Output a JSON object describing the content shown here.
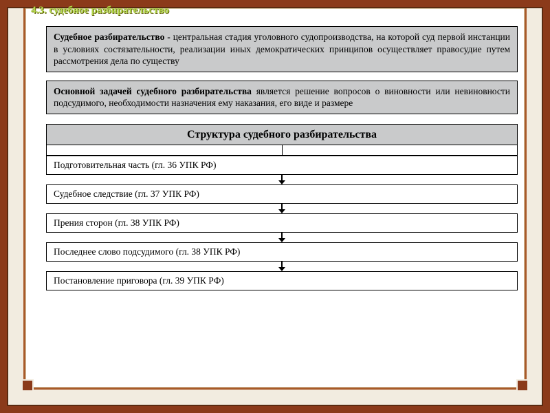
{
  "header": {
    "section_number": "4.3.",
    "section_title": "судебное разбирательство"
  },
  "definition": {
    "term": "Судебное разбирательство",
    "dash": " - ",
    "text": "центральная стадия уголовного судопроизводства, на которой суд первой инстанции в условиях состязательности, реализации иных демократических принципов осуществляет правосудие путем рассмотрения дела по существу"
  },
  "task": {
    "lead": "Основной задачей судебного разбирательства",
    "text": " является решение вопросов о виновности или невиновности подсудимого, необходимости назначения ему наказания, его виде и размере"
  },
  "structure": {
    "title": "Структура судебного разбирательства",
    "steps": [
      "Подготовительная часть (гл. 36 УПК РФ)",
      "Судебное следствие (гл. 37 УПК РФ)",
      "Прения сторон (гл. 38 УПК РФ)",
      "Последнее слово подсудимого (гл. 38 УПК РФ)",
      "Постановление приговора (гл. 39 УПК РФ)"
    ]
  }
}
